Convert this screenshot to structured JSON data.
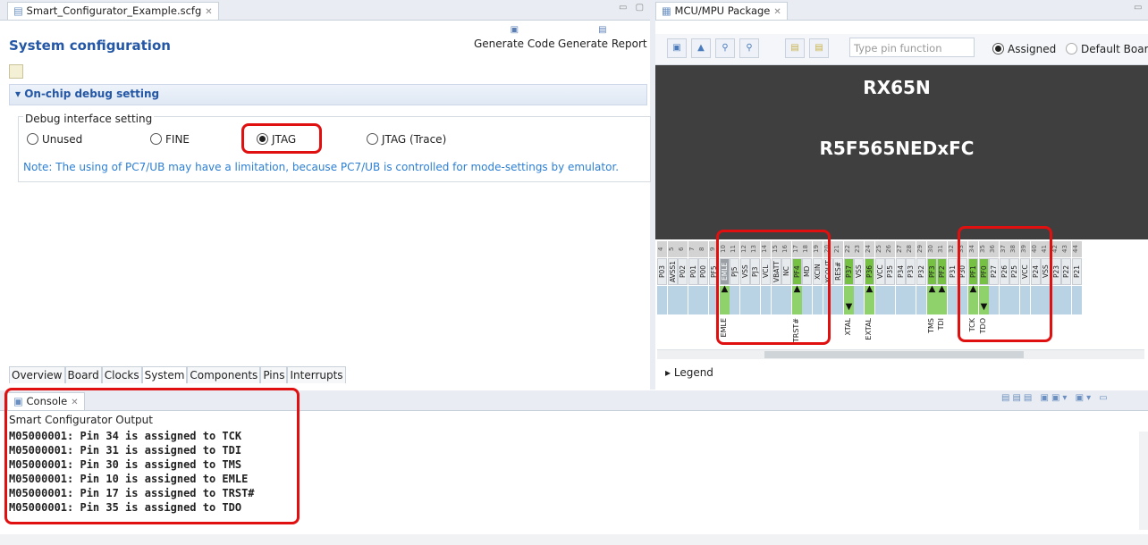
{
  "editor": {
    "tab_label": "Smart_Configurator_Example.scfg",
    "title": "System configuration",
    "generate_code": "Generate Code",
    "generate_report": "Generate Report",
    "section_title": "On-chip debug setting",
    "group_label": "Debug interface setting",
    "radios": [
      {
        "label": "Unused",
        "selected": false
      },
      {
        "label": "FINE",
        "selected": false
      },
      {
        "label": "JTAG",
        "selected": true
      },
      {
        "label": "JTAG (Trace)",
        "selected": false
      }
    ],
    "note": "Note: The using of PC7/UB may have a limitation, because PC7/UB is controlled for mode-settings by emulator.",
    "bottom_tabs": [
      "Overview",
      "Board",
      "Clocks",
      "System",
      "Components",
      "Pins",
      "Interrupts"
    ]
  },
  "package": {
    "tab_label": "MCU/MPU Package",
    "search_placeholder": "Type pin function",
    "radio_assigned": "Assigned",
    "radio_default": "Default Boar",
    "chip_family": "RX65N",
    "chip_part": "R5F565NEDxFC",
    "pins": [
      {
        "num": "4",
        "name": "P03",
        "assigned": false
      },
      {
        "num": "5",
        "name": "AVSS1",
        "assigned": false
      },
      {
        "num": "6",
        "name": "P02",
        "assigned": false
      },
      {
        "num": "7",
        "name": "P01",
        "assigned": false
      },
      {
        "num": "8",
        "name": "P00",
        "assigned": false
      },
      {
        "num": "9",
        "name": "PF5",
        "assigned": false
      },
      {
        "num": "10",
        "name": "EMLE",
        "assigned": "gray",
        "func": "EMLE",
        "dir": "up"
      },
      {
        "num": "11",
        "name": "PJ5",
        "assigned": false
      },
      {
        "num": "12",
        "name": "VSS",
        "assigned": false
      },
      {
        "num": "13",
        "name": "PJ3",
        "assigned": false
      },
      {
        "num": "14",
        "name": "VCL",
        "assigned": false
      },
      {
        "num": "15",
        "name": "VBATT",
        "assigned": false
      },
      {
        "num": "16",
        "name": "NC",
        "assigned": false
      },
      {
        "num": "17",
        "name": "PF4",
        "assigned": true,
        "func": "TRST#",
        "dir": "up"
      },
      {
        "num": "18",
        "name": "MD",
        "assigned": false
      },
      {
        "num": "19",
        "name": "XCIN",
        "assigned": false
      },
      {
        "num": "20",
        "name": "XCOUT",
        "assigned": false
      },
      {
        "num": "21",
        "name": "RES#",
        "assigned": false
      },
      {
        "num": "22",
        "name": "P37",
        "assigned": true,
        "func": "XTAL",
        "dir": "down"
      },
      {
        "num": "23",
        "name": "VSS",
        "assigned": false
      },
      {
        "num": "24",
        "name": "P36",
        "assigned": true,
        "func": "EXTAL",
        "dir": "up"
      },
      {
        "num": "25",
        "name": "VCC",
        "assigned": false
      },
      {
        "num": "26",
        "name": "P35",
        "assigned": false
      },
      {
        "num": "27",
        "name": "P34",
        "assigned": false
      },
      {
        "num": "28",
        "name": "P33",
        "assigned": false
      },
      {
        "num": "29",
        "name": "P32",
        "assigned": false
      },
      {
        "num": "30",
        "name": "PF3",
        "assigned": true,
        "func": "TMS",
        "dir": "up"
      },
      {
        "num": "31",
        "name": "PF2",
        "assigned": true,
        "func": "TDI",
        "dir": "up"
      },
      {
        "num": "32",
        "name": "P31",
        "assigned": false
      },
      {
        "num": "33",
        "name": "P30",
        "assigned": false
      },
      {
        "num": "34",
        "name": "PF1",
        "assigned": true,
        "func": "TCK",
        "dir": "up"
      },
      {
        "num": "35",
        "name": "PF0",
        "assigned": true,
        "func": "TDO",
        "dir": "down"
      },
      {
        "num": "36",
        "name": "P27",
        "assigned": false
      },
      {
        "num": "37",
        "name": "P26",
        "assigned": false
      },
      {
        "num": "38",
        "name": "P25",
        "assigned": false
      },
      {
        "num": "39",
        "name": "VCC",
        "assigned": false
      },
      {
        "num": "40",
        "name": "P24",
        "assigned": false
      },
      {
        "num": "41",
        "name": "VSS",
        "assigned": false
      },
      {
        "num": "42",
        "name": "P23",
        "assigned": false
      },
      {
        "num": "43",
        "name": "P22",
        "assigned": false
      },
      {
        "num": "44",
        "name": "P21",
        "assigned": false
      }
    ],
    "legend": "Legend"
  },
  "console": {
    "tab_label": "Console",
    "title": "Smart Configurator Output",
    "lines": [
      "M05000001: Pin 34 is assigned to TCK",
      "M05000001: Pin 31 is assigned to TDI",
      "M05000001: Pin 30 is assigned to TMS",
      "M05000001: Pin 10 is assigned to EMLE",
      "M05000001: Pin 17 is assigned to TRST#",
      "M05000001: Pin 35 is assigned to TDO"
    ]
  },
  "colors": {
    "accent": "#2457a5",
    "highlight": "#e01010",
    "assigned_pin": "#76c043",
    "note": "#2c7fd4"
  }
}
